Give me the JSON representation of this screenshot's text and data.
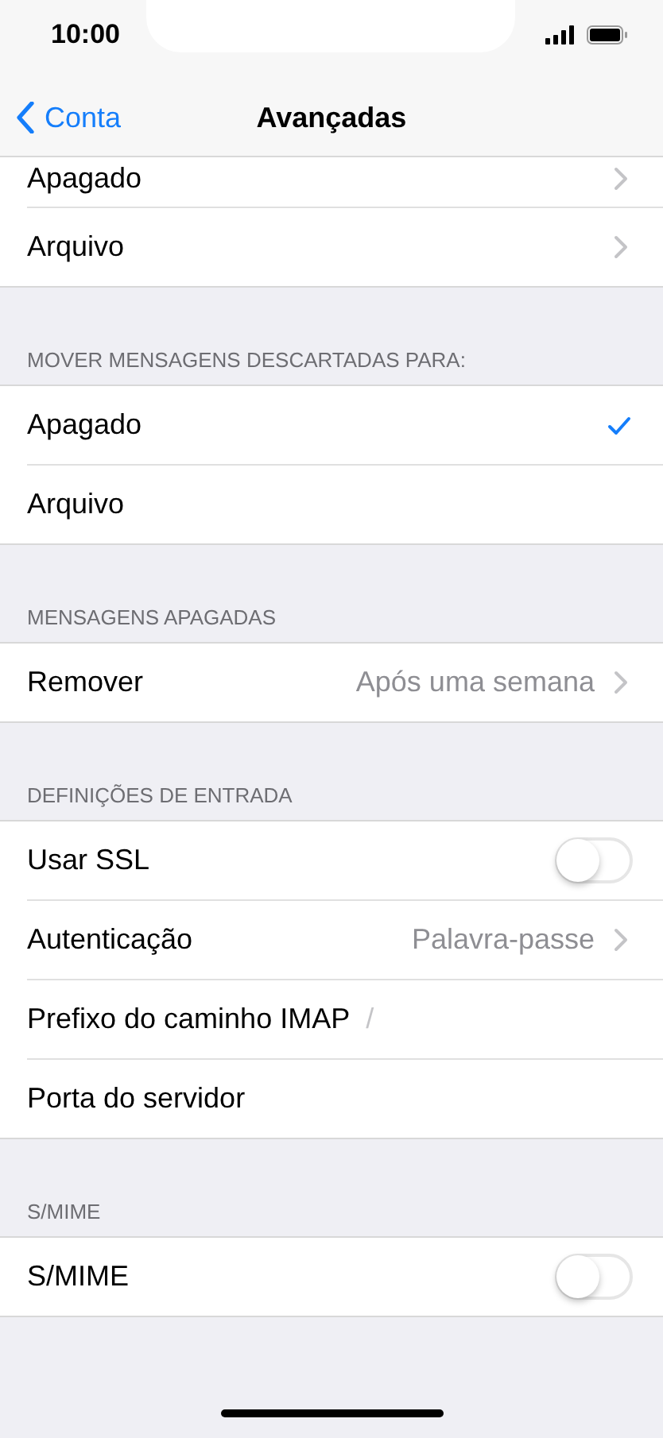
{
  "status_bar": {
    "time": "10:00"
  },
  "nav": {
    "back": "Conta",
    "title": "Avançadas"
  },
  "sections": [
    {
      "rows": [
        {
          "kind": "link",
          "label": "Apagado"
        },
        {
          "kind": "link",
          "label": "Arquivo"
        }
      ]
    },
    {
      "header": "MOVER MENSAGENS DESCARTADAS PARA:",
      "rows": [
        {
          "kind": "choice",
          "label": "Apagado",
          "selected": true
        },
        {
          "kind": "choice",
          "label": "Arquivo",
          "selected": false
        }
      ]
    },
    {
      "header": "MENSAGENS APAGADAS",
      "rows": [
        {
          "kind": "link",
          "label": "Remover",
          "value": "Após uma semana"
        }
      ]
    },
    {
      "header": "DEFINIÇÕES DE ENTRADA",
      "rows": [
        {
          "kind": "toggle",
          "label": "Usar SSL",
          "on": false
        },
        {
          "kind": "link",
          "label": "Autenticação",
          "value": "Palavra-passe"
        },
        {
          "kind": "field",
          "label": "Prefixo do caminho IMAP",
          "placeholder": "/"
        },
        {
          "kind": "field",
          "label": "Porta do servidor"
        }
      ]
    },
    {
      "header": "S/MIME",
      "rows": [
        {
          "kind": "toggle",
          "label": "S/MIME",
          "on": false
        }
      ]
    }
  ]
}
